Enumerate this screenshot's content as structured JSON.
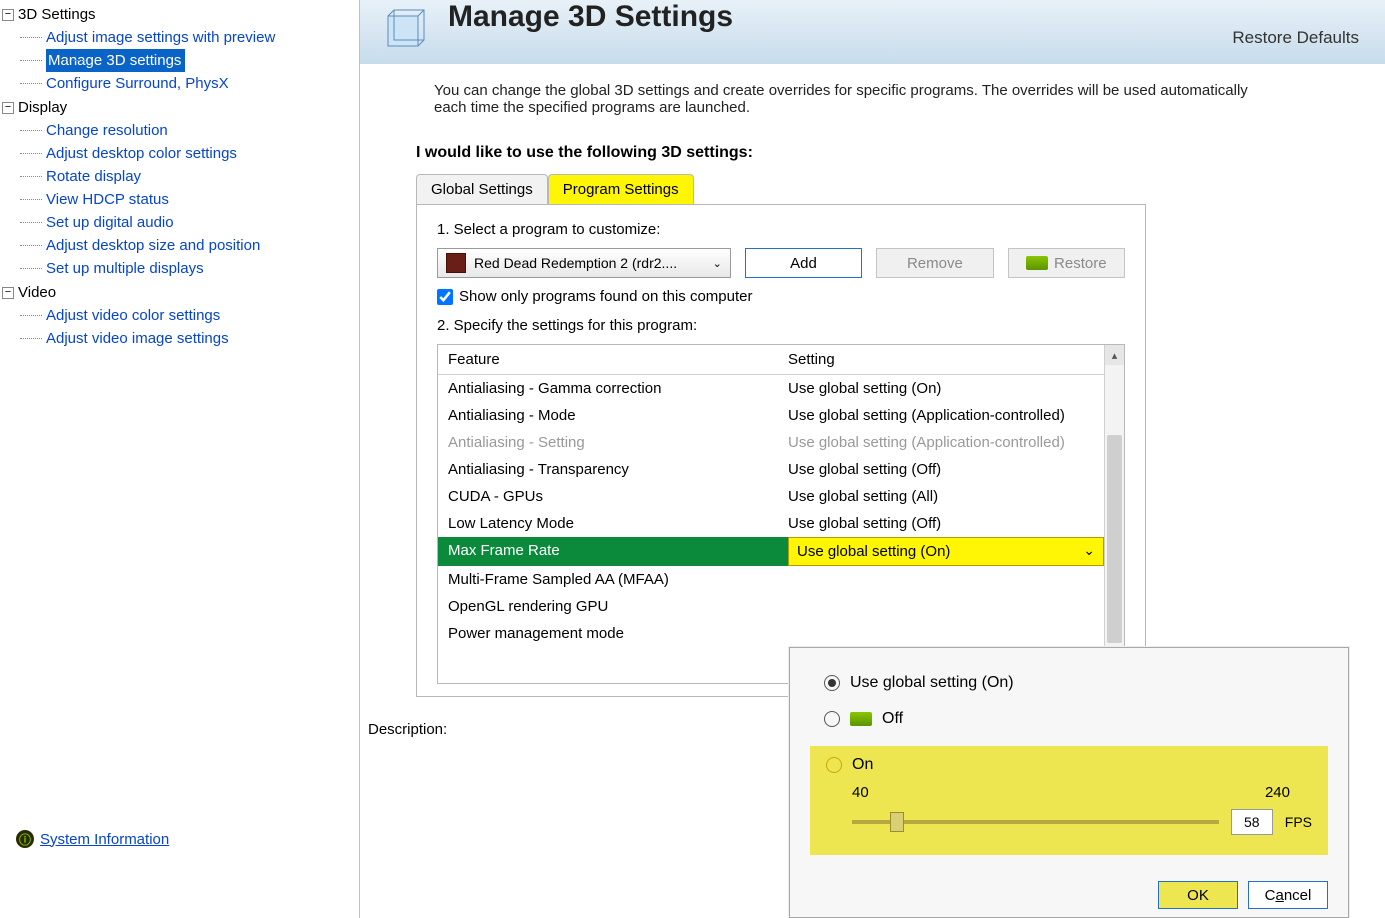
{
  "sidebar": {
    "groups": [
      {
        "label": "3D Settings",
        "items": [
          "Adjust image settings with preview",
          "Manage 3D settings",
          "Configure Surround, PhysX"
        ],
        "selected_index": 1
      },
      {
        "label": "Display",
        "items": [
          "Change resolution",
          "Adjust desktop color settings",
          "Rotate display",
          "View HDCP status",
          "Set up digital audio",
          "Adjust desktop size and position",
          "Set up multiple displays"
        ]
      },
      {
        "label": "Video",
        "items": [
          "Adjust video color settings",
          "Adjust video image settings"
        ]
      }
    ],
    "sysinfo": "System Information"
  },
  "header": {
    "title": "Manage 3D Settings",
    "restore": "Restore Defaults",
    "intro": "You can change the global 3D settings and create overrides for specific programs. The overrides will be used automatically each time the specified programs are launched.",
    "section": "I would like to use the following 3D settings:"
  },
  "tabs": {
    "global": "Global Settings",
    "program": "Program Settings"
  },
  "steps": {
    "s1": "1. Select a program to customize:",
    "s2": "2. Specify the settings for this program:",
    "program": "Red Dead Redemption 2 (rdr2....",
    "add": "Add",
    "remove": "Remove",
    "restore": "Restore",
    "showonly": "Show only programs found on this computer"
  },
  "table": {
    "hdr_feature": "Feature",
    "hdr_setting": "Setting",
    "rows": [
      {
        "f": "Antialiasing - Gamma correction",
        "s": "Use global setting (On)"
      },
      {
        "f": "Antialiasing - Mode",
        "s": "Use global setting (Application-controlled)"
      },
      {
        "f": "Antialiasing - Setting",
        "s": "Use global setting (Application-controlled)",
        "disabled": true
      },
      {
        "f": "Antialiasing - Transparency",
        "s": "Use global setting (Off)"
      },
      {
        "f": "CUDA - GPUs",
        "s": "Use global setting (All)"
      },
      {
        "f": "Low Latency Mode",
        "s": "Use global setting (Off)"
      },
      {
        "f": "Max Frame Rate",
        "s": "Use global setting (On)",
        "selected": true
      },
      {
        "f": "Multi-Frame Sampled AA (MFAA)",
        "s": ""
      },
      {
        "f": "OpenGL rendering GPU",
        "s": ""
      },
      {
        "f": "Power management mode",
        "s": ""
      }
    ]
  },
  "desc": "Description:",
  "popup": {
    "opt1": "Use global setting (On)",
    "opt2": "Off",
    "opt3": "On",
    "min": "40",
    "max": "240",
    "value": "58",
    "unit": "FPS",
    "ok": "OK",
    "cancel_pre": "C",
    "cancel_u": "a",
    "cancel_post": "ncel"
  }
}
